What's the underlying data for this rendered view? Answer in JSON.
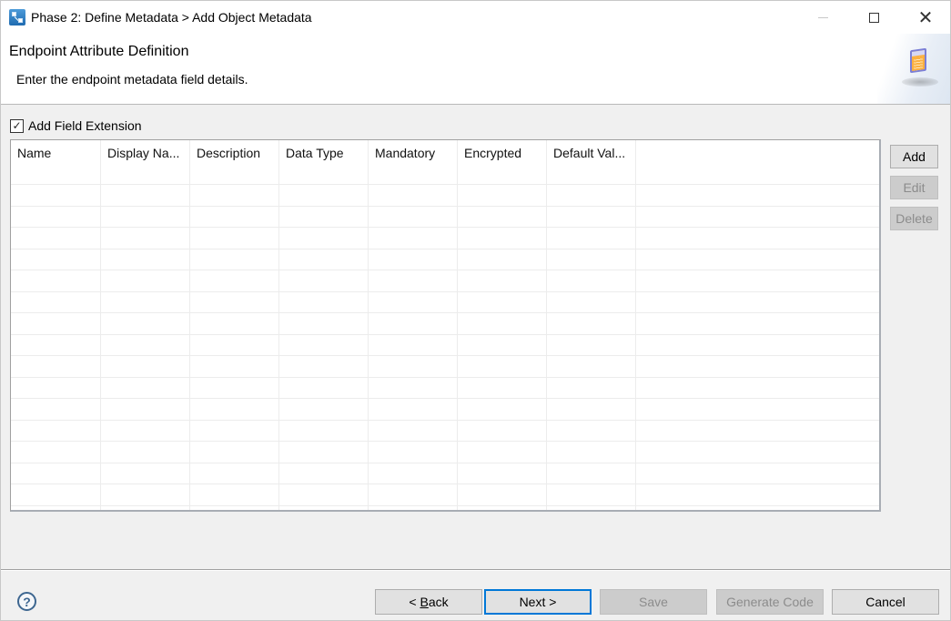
{
  "window": {
    "title": "Phase 2: Define Metadata > Add Object Metadata",
    "app_icon": "workflow-nodes-icon",
    "controls": {
      "minimize": "minimize-icon",
      "maximize": "maximize-icon",
      "close_glyph": "✕"
    }
  },
  "banner": {
    "title": "Endpoint Attribute Definition",
    "subtitle": "Enter the endpoint metadata field details.",
    "icon": "spreadsheet-icon"
  },
  "add_field_extension": {
    "label": "Add Field Extension",
    "checked": true,
    "check_glyph": "✓"
  },
  "table": {
    "columns": [
      "Name",
      "Display Na...",
      "Description",
      "Data Type",
      "Mandatory",
      "Encrypted",
      "Default Val..."
    ],
    "rows": []
  },
  "side_buttons": {
    "add": {
      "label": "Add",
      "enabled": true
    },
    "edit": {
      "label": "Edit",
      "enabled": false
    },
    "delete": {
      "label": "Delete",
      "enabled": false
    }
  },
  "footer": {
    "help_glyph": "?",
    "back": {
      "prefix": "< ",
      "mnemonic": "B",
      "rest": "ack",
      "enabled": true
    },
    "next": {
      "label": "Next >",
      "enabled": true,
      "default": true
    },
    "save": {
      "label": "Save",
      "enabled": false
    },
    "generate_code": {
      "label": "Generate Code",
      "enabled": false
    },
    "cancel": {
      "label": "Cancel",
      "enabled": true
    }
  }
}
